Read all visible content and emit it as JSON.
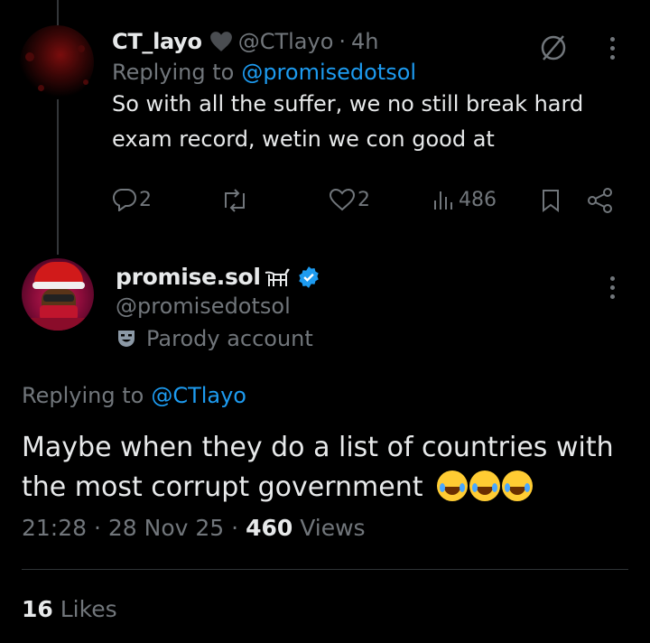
{
  "reply_tweet": {
    "display_name": "CT_layo",
    "handle": "@CTlayo",
    "time": "4h",
    "replying_prefix": "Replying to",
    "replying_to": "@promisedotsol",
    "text": "So with all the suffer, we no still break hard exam record, wetin we con good at",
    "replies": "2",
    "likes": "2",
    "views": "486"
  },
  "main_tweet": {
    "display_name": "promise.sol",
    "handle": "@promisedotsol",
    "label": "Parody account",
    "replying_prefix": "Replying to",
    "replying_to": "@CTlayo",
    "text": "Maybe when they do a list of countries with the most corrupt government",
    "time": "21:28",
    "date": "28 Nov 25",
    "views_count": "460",
    "views_label": "Views",
    "likes_count": "16",
    "likes_label": "Likes"
  },
  "colors": {
    "accent": "#1d9bf0",
    "muted": "#71767b",
    "background": "#000000",
    "text": "#e7e9ea"
  },
  "icons": [
    "heart-icon",
    "grok-icon",
    "more-icon",
    "reply-icon",
    "retweet-icon",
    "like-icon",
    "views-icon",
    "bookmark-icon",
    "share-icon",
    "goat-icon",
    "verified-icon",
    "parody-mask-icon",
    "laughing-tears-emoji"
  ]
}
